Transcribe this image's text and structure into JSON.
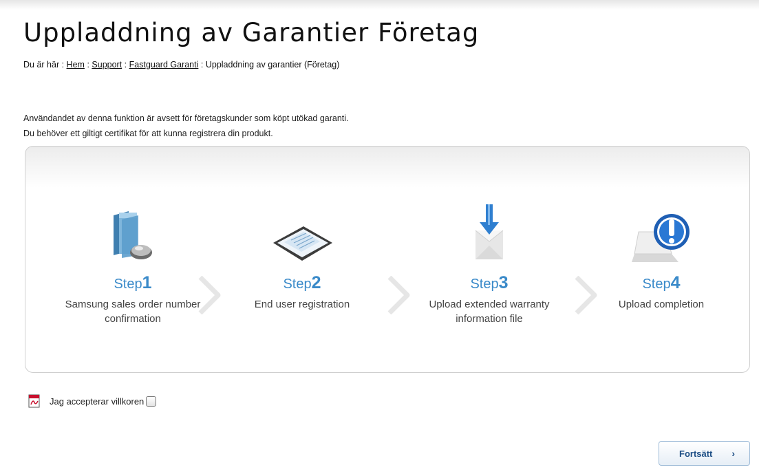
{
  "page": {
    "title": "Uppladdning av Garantier Företag"
  },
  "breadcrumb": {
    "prefix": "Du är här :",
    "items": [
      "Hem",
      "Support",
      "Fastguard Garanti"
    ],
    "separator": ":",
    "current": "Uppladdning av garantier (Företag)"
  },
  "intro": {
    "line1": "Användandet av denna funktion är avsett för företagskunder som köpt utökad garanti.",
    "line2": "Du behöver ett giltigt certifikat för att kunna registrera din produkt."
  },
  "steps": [
    {
      "label": "Step",
      "num": "1",
      "desc": "Samsung sales order number confirmation",
      "icon": "folder-mouse-icon"
    },
    {
      "label": "Step",
      "num": "2",
      "desc": "End user registration",
      "icon": "document-tablet-icon"
    },
    {
      "label": "Step",
      "num": "3",
      "desc": "Upload extended warranty information file",
      "icon": "upload-arrow-icon"
    },
    {
      "label": "Step",
      "num": "4",
      "desc": "Upload completion",
      "icon": "laptop-info-icon"
    }
  ],
  "accept": {
    "label": "Jag accepterar villkoren",
    "checked": false,
    "icon": "pdf-icon"
  },
  "continue_button": {
    "label": "Fortsätt",
    "arrow": "›"
  },
  "colors": {
    "step_blue": "#3a8ac9",
    "button_text": "#1e4f86"
  }
}
